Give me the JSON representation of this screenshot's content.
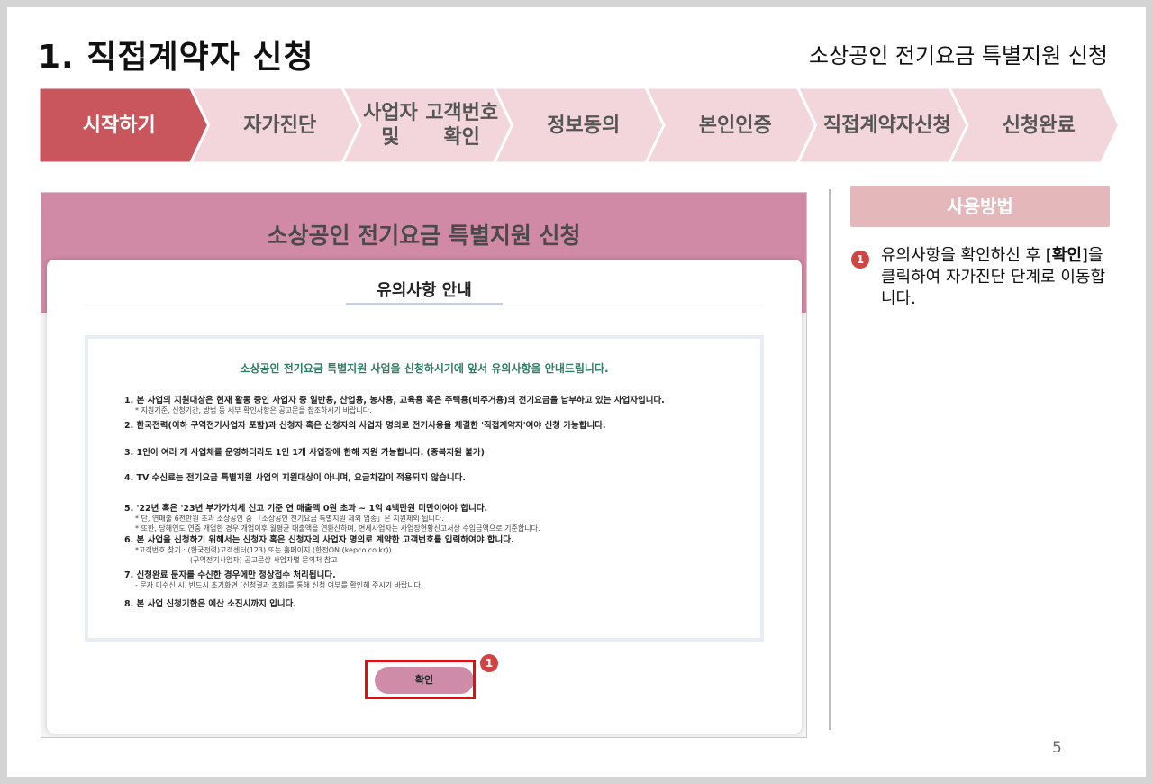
{
  "slide_title": "1. 직접계약자 신청",
  "slide_subtitle": "소상공인 전기요금 특별지원 신청",
  "steps": [
    {
      "label": "시작하기",
      "active": true
    },
    {
      "label": "자가진단",
      "active": false
    },
    {
      "label": "사업자 및\n고객번호확인",
      "active": false
    },
    {
      "label": "정보동의",
      "active": false
    },
    {
      "label": "본인인증",
      "active": false
    },
    {
      "label": "직접계약자\n신청",
      "active": false
    },
    {
      "label": "신청완료",
      "active": false
    }
  ],
  "colors": {
    "step_active": "#c8565c",
    "step_inactive": "#f2d6dc",
    "header_bg": "#d08aa5",
    "button_bg": "#cf8ca8",
    "highlight": "#e01010",
    "badge": "#d04444"
  },
  "screenshot": {
    "header_title": "소상공인 전기요금 특별지원 신청",
    "modal_tab": "유의사항 안내",
    "intro": "소상공인 전기요금 특별지원 사업을 신청하시기에 앞서 유의사항을 안내드립니다.",
    "items": [
      {
        "text": "1. 본 사업의 지원대상은 현재 활동 중인 사업자 중 일반용, 산업용, 농사용, 교육용 혹은 주택용(비주거용)의 전기요금을 납부하고 있는 사업자입니다.",
        "subs": [
          "* 지원기준, 신청기간, 방법 등 세부 확인사항은 공고문을 참조하시기 바랍니다."
        ]
      },
      {
        "text": "2. 한국전력(이하 구역전기사업자 포함)과 신청자 혹은 신청자의 사업자 명의로 전기사용을 체결한 '직접계약자'여야 신청 가능합니다.",
        "subs": []
      },
      {
        "text": "3. 1인이 여러 개 사업체를 운영하더라도 1인 1개 사업장에 한해 지원 가능합니다. (중복지원 불가)",
        "subs": []
      },
      {
        "text": "4. TV 수신료는 전기요금 특별지원 사업의 지원대상이 아니며, 요금차감이 적용되지 않습니다.",
        "subs": []
      },
      {
        "text": "5. '22년 혹은 '23년 부가가치세 신고 기준 연 매출액 0원 초과 ~ 1억 4백만원 미만이여야 합니다.",
        "subs": [
          "* 단, 연매출 6천만원 초과 소상공인 중 「소상공인 전기요금 특별지원 제외 업종」은 지원제외 됩니다.",
          "* 또한, 당해연도 연중 개업한 경우 개업이후 월평균 매출액을 연환산하며, 면세사업자는 사업장현황신고서상 수입금액으로 기준합니다."
        ]
      },
      {
        "text": "6. 본 사업을 신청하기 위해서는 신청자 혹은 신청자의 사업자 명의로 계약한 고객번호를 입력하여야 합니다.",
        "subs": [
          "*고객번호 찾기 : (한국전력)고객센터(123) 또는 홈페이지 (한전ON (kepco.co.kr))",
          "                        (구역전기사업자) 공고문상 사업자별 문의처 참고"
        ]
      },
      {
        "text": "7. 신청완료 문자를 수신한 경우에만 정상접수 처리됩니다.",
        "subs": [
          "- 문자 미수신 시, 반드시 초기화면 [신청결과 조회]를 통해 신청 여부를 확인해 주시기 바랍니다."
        ]
      },
      {
        "text": "8. 본 사업 신청기한은 예산 소진시까지 입니다.",
        "subs": []
      }
    ],
    "confirm_label": "확인",
    "badge_number": "1"
  },
  "howto": {
    "header": "사용방법",
    "badge_number": "1",
    "text_before": "유의사항을 확인하신 후 [",
    "text_bold": "확인",
    "text_after": "]을 클릭하여 자가진단 단계로 이동합니다."
  },
  "page_number": "5"
}
